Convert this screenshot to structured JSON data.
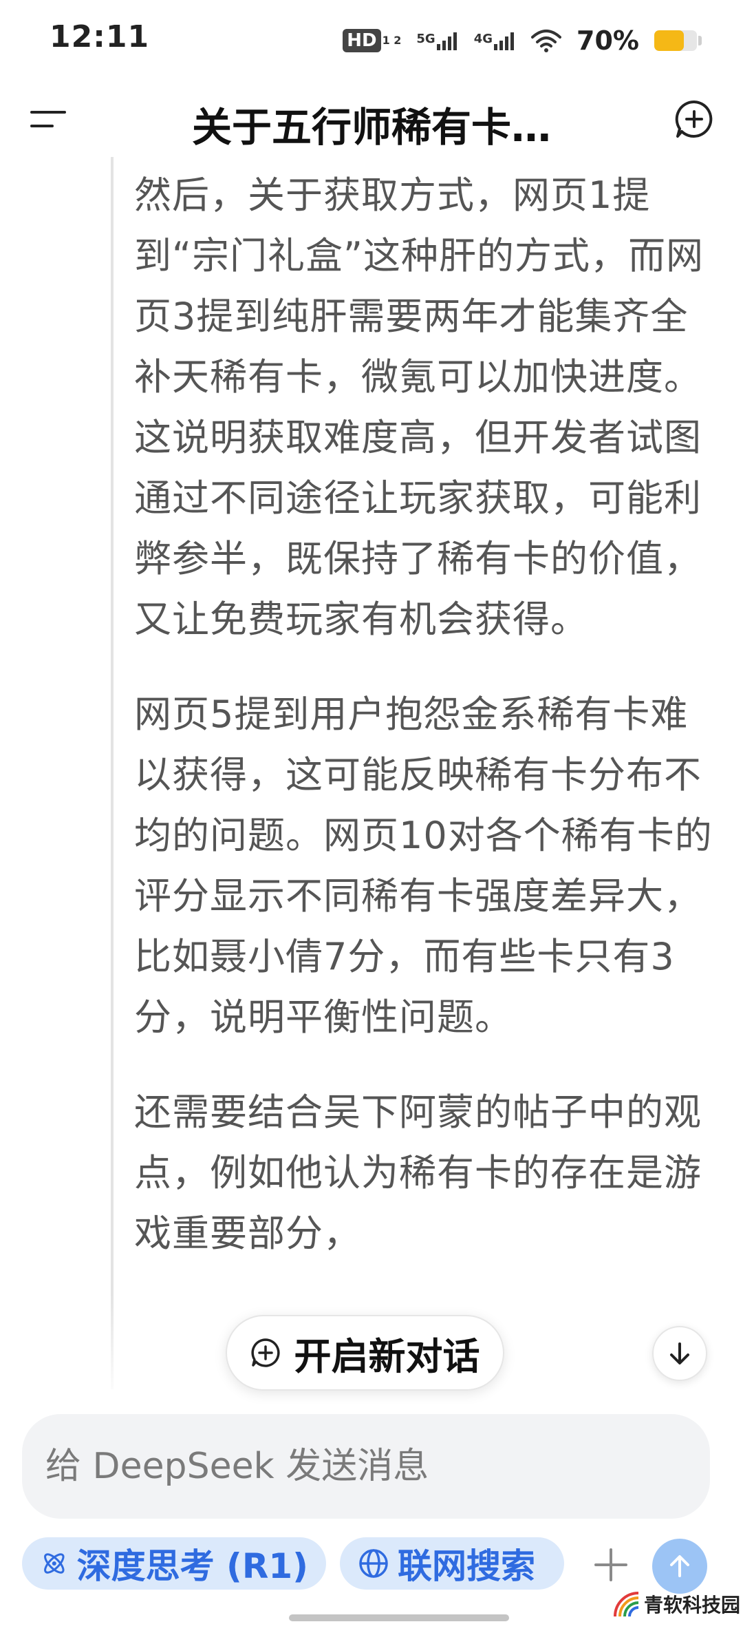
{
  "status_bar": {
    "time": "12:11",
    "hd_label": "HD",
    "hd_sub": "1 2",
    "net1": "5G",
    "net2": "4G",
    "battery_percent_text": "70%",
    "battery_level": 0.7,
    "battery_color": "#f5b816"
  },
  "header": {
    "title": "关于五行师稀有卡…",
    "menu_icon": "menu-icon",
    "new_chat_icon": "new-chat-icon"
  },
  "content": {
    "paragraphs": [
      "然后，关于获取方式，网页1提到“宗门礼盒”这种肝的方式，而网页3提到纯肝需要两年才能集齐全补天稀有卡，微氪可以加快进度。这说明获取难度高，但开发者试图通过不同途径让玩家获取，可能利弊参半，既保持了稀有卡的价值，又让免费玩家有机会获得。",
      "网页5提到用户抱怨金系稀有卡难以获得，这可能反映稀有卡分布不均的问题。网页10对各个稀有卡的评分显示不同稀有卡强度差异大，比如聂小倩7分，而有些卡只有3分，说明平衡性问题。",
      "还需要结合吴下阿蒙的帖子中的观点，例如他认为稀有卡的存在是游戏重要部分，"
    ]
  },
  "floating": {
    "new_chat_label": "开启新对话",
    "scroll_down_icon": "arrow-down-icon"
  },
  "composer": {
    "placeholder": "给 DeepSeek 发送消息",
    "value": ""
  },
  "actions": {
    "deep_think_label": "深度思考 (R1)",
    "web_search_label": "联网搜索",
    "accent_color": "#2f6be0",
    "chip_bg": "#dbe9fb"
  },
  "watermark": {
    "text": "青软科技园"
  }
}
